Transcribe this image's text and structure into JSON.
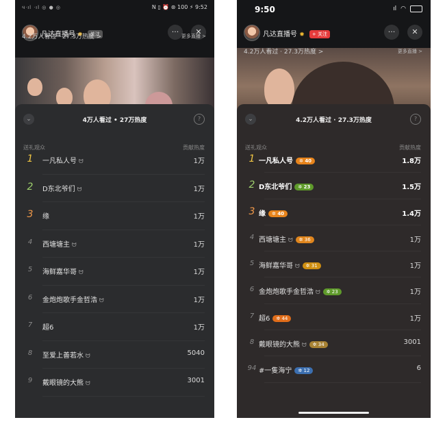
{
  "left": {
    "statusbar": {
      "signals": "᪪ᐧıl ᐧıl ◎ ● ◎",
      "right": "N ▯ ⏰ ⊛ 100 ⚡ 9:52"
    },
    "streamer": "凡达直播号",
    "follow": "关注",
    "stats": "4.2万人看过 · 27.3万热度 >",
    "more_lives": "更多直播 >",
    "panel_title": "4万人看过 • 27万热度",
    "col_left": "送礼观众",
    "col_right": "贡献热度",
    "rows": [
      {
        "rank": "1",
        "name": "一凡私人号",
        "bow": true,
        "value": "1万"
      },
      {
        "rank": "2",
        "name": "D东北爷们",
        "bow": true,
        "value": "1万"
      },
      {
        "rank": "3",
        "name": "缘",
        "bow": false,
        "value": "1万"
      },
      {
        "rank": "4",
        "name": "西塘塘主",
        "bow": true,
        "value": "1万"
      },
      {
        "rank": "5",
        "name": "海鲜嘉华哥",
        "bow": true,
        "value": "1万"
      },
      {
        "rank": "6",
        "name": "金炮炮歌手金哲浩",
        "bow": true,
        "value": "1万"
      },
      {
        "rank": "7",
        "name": "超6",
        "bow": false,
        "value": "1万"
      },
      {
        "rank": "8",
        "name": "至爱上善若水",
        "bow": true,
        "value": "5040"
      },
      {
        "rank": "9",
        "name": "戴眼镜的大熊",
        "bow": true,
        "value": "3001"
      }
    ]
  },
  "right": {
    "statusbar": {
      "time": "9:50"
    },
    "streamer": "凡达直播号",
    "follow": "+ 关注",
    "stats": "4.2万人看过 · 27.3万热度 >",
    "more_lives": "更多直播 >",
    "panel_title": "4.2万人看过 · 27.3万热度",
    "col_left": "送礼观众",
    "col_right": "贡献热度",
    "rows": [
      {
        "rank": "1",
        "name": "一凡私人号",
        "level": "40",
        "level_color": "#e7841c",
        "value": "1.8万",
        "top": true
      },
      {
        "rank": "2",
        "name": "D东北爷们",
        "level": "23",
        "level_color": "#5f9a2b",
        "value": "1.5万",
        "top": true
      },
      {
        "rank": "3",
        "name": "缘",
        "level": "40",
        "level_color": "#e7841c",
        "value": "1.4万",
        "top": true
      },
      {
        "rank": "4",
        "name": "西塘塘主",
        "bow": true,
        "level": "36",
        "level_color": "#e0861e",
        "value": "1万"
      },
      {
        "rank": "5",
        "name": "海鲜嘉华哥",
        "bow": true,
        "level": "31",
        "level_color": "#cf8f12",
        "value": "1万"
      },
      {
        "rank": "6",
        "name": "金炮炮歌手金哲浩",
        "bow": true,
        "level": "23",
        "level_color": "#5f9a2b",
        "value": "1万"
      },
      {
        "rank": "7",
        "name": "超6",
        "level": "44",
        "level_color": "#e06d1a",
        "value": "1万"
      },
      {
        "rank": "8",
        "name": "戴眼镜的大熊",
        "bow": true,
        "level": "34",
        "level_color": "#a88234",
        "value": "3001"
      },
      {
        "rank": "94",
        "name": "#一隻海宁",
        "level": "12",
        "level_color": "#3c6fb0",
        "value": "6"
      }
    ]
  },
  "bow_glyph": "ᗢ"
}
